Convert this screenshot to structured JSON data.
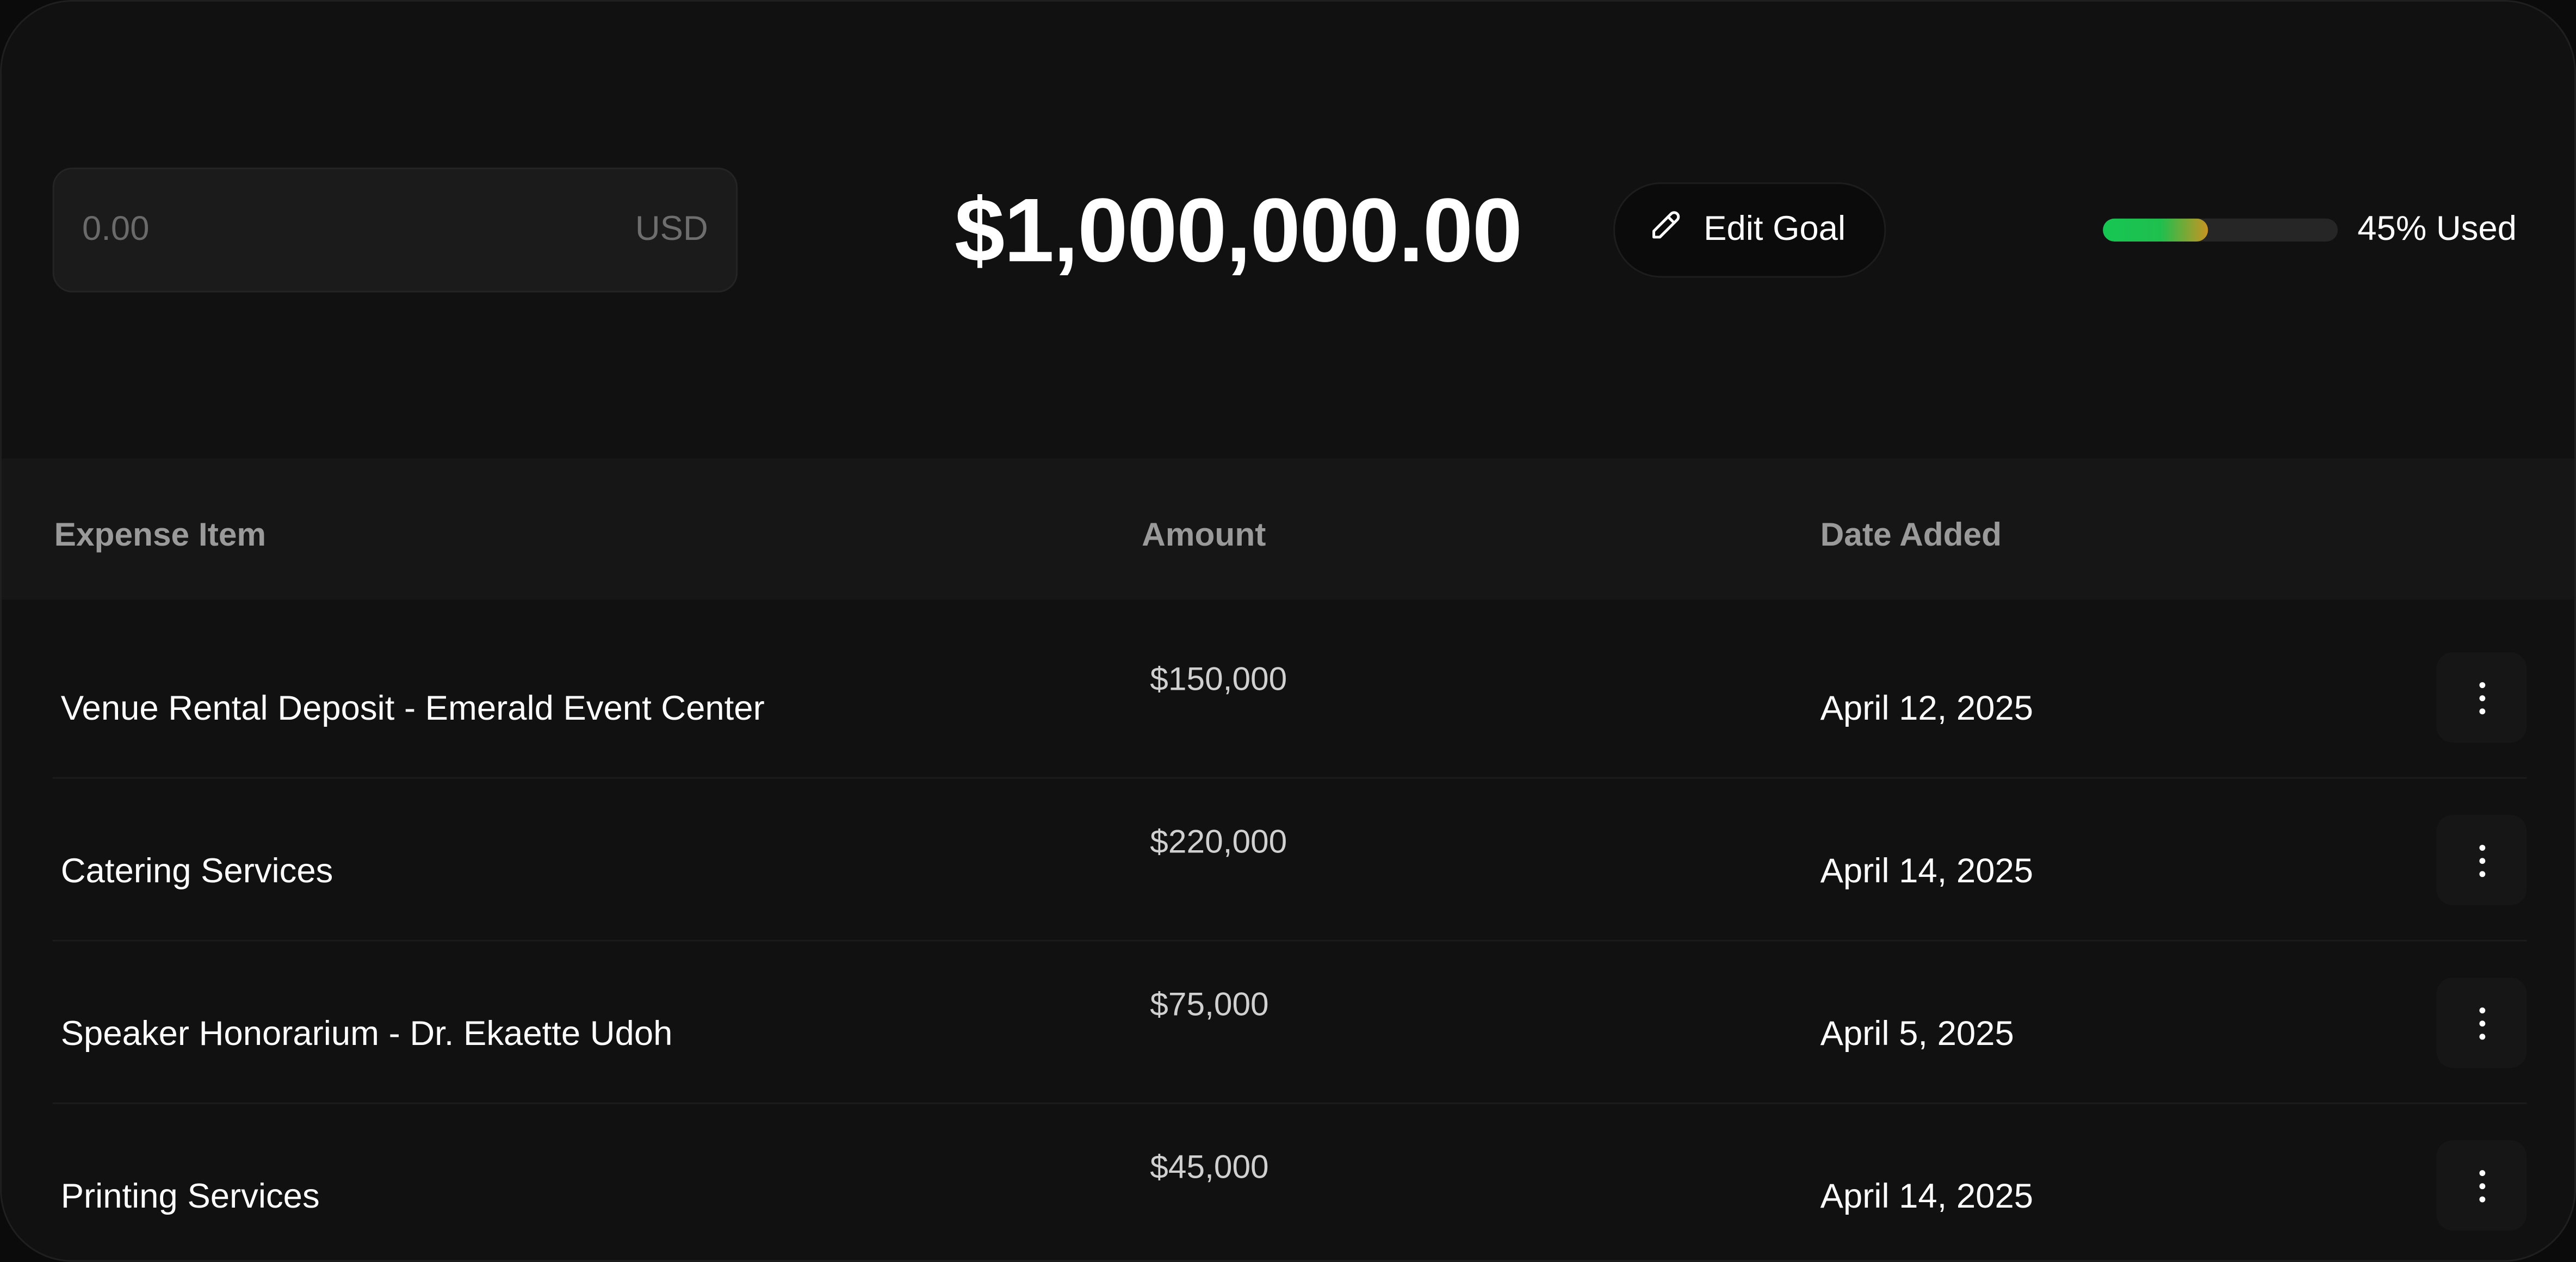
{
  "goal": {
    "input_placeholder": "0.00",
    "currency": "USD",
    "total": "$1,000,000.00",
    "edit_label": "Edit Goal",
    "used_percent": 45,
    "used_label": "45% Used"
  },
  "table": {
    "headers": [
      "Expense Item",
      "Amount",
      "Date Added"
    ],
    "rows": [
      {
        "item": "Venue Rental Deposit - Emerald Event Center",
        "amount": "$150,000",
        "date": "April 12, 2025"
      },
      {
        "item": "Catering Services",
        "amount": "$220,000",
        "date": "April 14, 2025"
      },
      {
        "item": "Speaker Honorarium - Dr. Ekaette Udoh",
        "amount": "$75,000",
        "date": "April 5, 2025"
      },
      {
        "item": "Printing Services",
        "amount": "$45,000",
        "date": "April 14, 2025"
      }
    ]
  },
  "icons": {
    "edit": "pencil-icon",
    "row_menu": "more-vertical-icon"
  },
  "colors": {
    "progress_start": "#16c653",
    "progress_end": "#c89422",
    "background": "#111111"
  }
}
